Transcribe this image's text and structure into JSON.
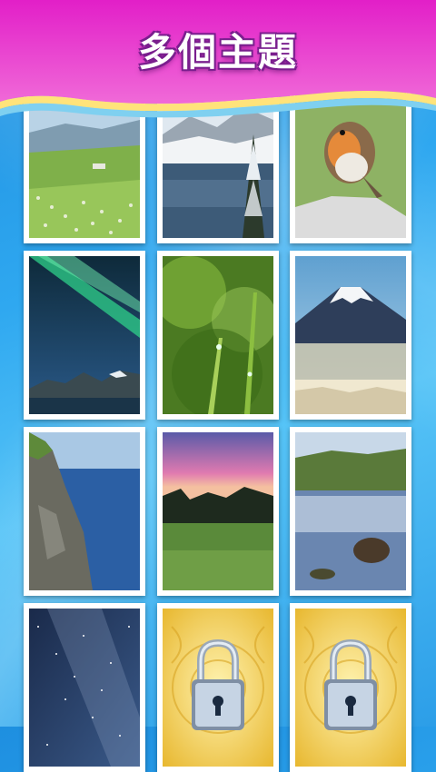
{
  "header": {
    "title": "多個主題"
  },
  "themes": [
    {
      "scene": "meadow",
      "locked": false
    },
    {
      "scene": "snow-lake",
      "locked": false
    },
    {
      "scene": "robin",
      "locked": false
    },
    {
      "scene": "aurora",
      "locked": false
    },
    {
      "scene": "grass-dew",
      "locked": false
    },
    {
      "scene": "mount-fuji",
      "locked": false
    },
    {
      "scene": "sea-cliff",
      "locked": false
    },
    {
      "scene": "sunset-field",
      "locked": false
    },
    {
      "scene": "pond-reflection",
      "locked": false
    },
    {
      "scene": "starry-sky",
      "locked": false
    },
    {
      "scene": "locked",
      "locked": true
    },
    {
      "scene": "locked",
      "locked": true
    }
  ]
}
